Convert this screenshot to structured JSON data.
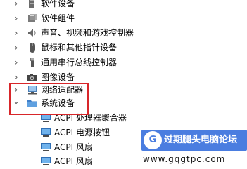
{
  "tree": {
    "items": [
      {
        "label": "软件设备",
        "expanded": false,
        "icon": "software-device-icon"
      },
      {
        "label": "软件组件",
        "expanded": false,
        "icon": "software-component-icon"
      },
      {
        "label": "声音、视频和游戏控制器",
        "expanded": false,
        "icon": "speaker-icon"
      },
      {
        "label": "鼠标和其他指针设备",
        "expanded": false,
        "icon": "mouse-icon"
      },
      {
        "label": "通用串行总线控制器",
        "expanded": false,
        "icon": "usb-icon"
      },
      {
        "label": "图像设备",
        "expanded": false,
        "icon": "camera-icon"
      },
      {
        "label": "网络适配器",
        "expanded": false,
        "icon": "network-icon"
      },
      {
        "label": "系统设备",
        "expanded": true,
        "icon": "system-folder-icon"
      }
    ],
    "children": [
      {
        "label": "ACPI 处理器聚合器",
        "icon": "monitor-icon"
      },
      {
        "label": "ACPI 电源按钮",
        "icon": "monitor-icon"
      },
      {
        "label": "ACPI 风扇",
        "icon": "monitor-icon"
      },
      {
        "label": "ACPI 风扇",
        "icon": "monitor-icon"
      }
    ],
    "chevron_collapsed": "›",
    "chevron_expanded": "⌄"
  },
  "highlight_color": "#d8262a",
  "watermark": {
    "logo": "G",
    "title": "过期腿头电脑论坛",
    "url": "www.gqgtpc.com",
    "color": "#4a7de0"
  }
}
